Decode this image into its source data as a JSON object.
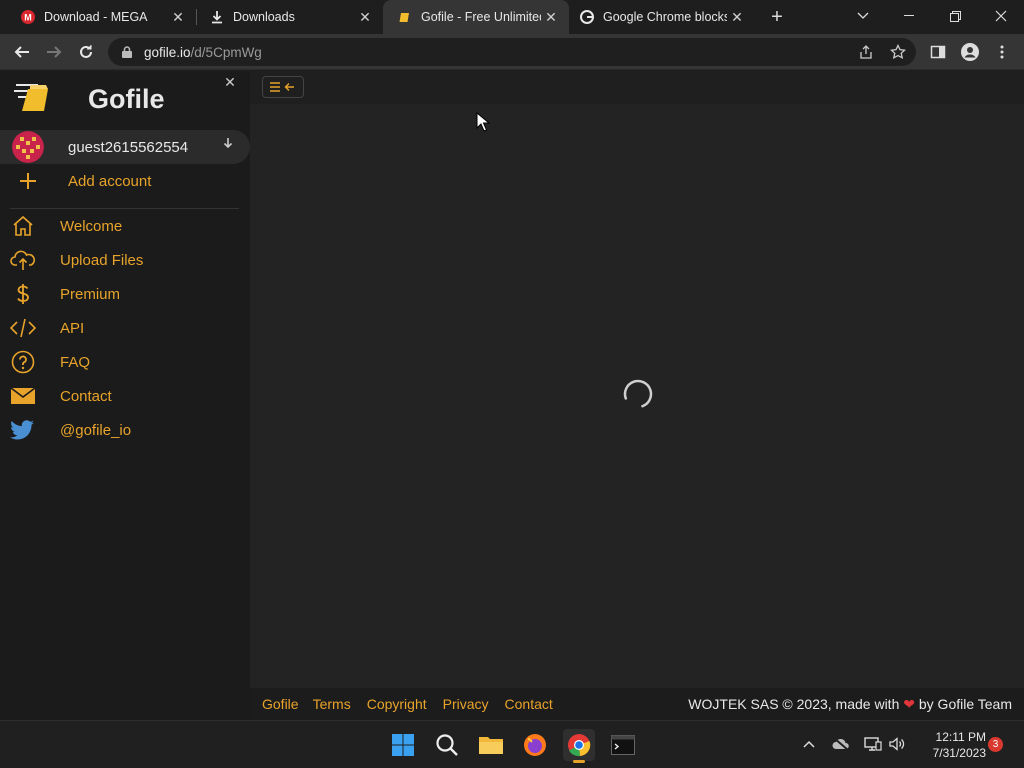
{
  "browser": {
    "tabs": [
      {
        "title": "Download - MEGA",
        "icon": "mega-icon",
        "active": false
      },
      {
        "title": "Downloads",
        "icon": "download-icon",
        "active": false
      },
      {
        "title": "Gofile - Free Unlimited",
        "icon": "gofile-icon",
        "active": true
      },
      {
        "title": "Google Chrome blocks",
        "icon": "google-icon",
        "active": false
      }
    ],
    "url_host": "gofile.io",
    "url_path": "/d/5CpmWg"
  },
  "sidebar": {
    "brand": "Gofile",
    "account_name": "guest2615562554",
    "add_account": "Add account",
    "items": [
      {
        "label": "Welcome",
        "icon": "home-icon"
      },
      {
        "label": "Upload Files",
        "icon": "upload-cloud-icon"
      },
      {
        "label": "Premium",
        "icon": "dollar-icon"
      },
      {
        "label": "API",
        "icon": "code-icon"
      },
      {
        "label": "FAQ",
        "icon": "question-icon"
      },
      {
        "label": "Contact",
        "icon": "envelope-icon"
      },
      {
        "label": "@gofile_io",
        "icon": "twitter-icon"
      }
    ]
  },
  "footer": {
    "links": [
      "Gofile",
      "Terms",
      "Copyright",
      "Privacy",
      "Contact"
    ],
    "copyright_prefix": "WOJTEK SAS © 2023, made with",
    "copyright_suffix": "by Gofile Team"
  },
  "taskbar": {
    "time": "12:11 PM",
    "date": "7/31/2023",
    "notifications": "3"
  },
  "colors": {
    "accent": "#e8a32a",
    "background": "#232323",
    "sidebar": "#1b1b1b"
  }
}
